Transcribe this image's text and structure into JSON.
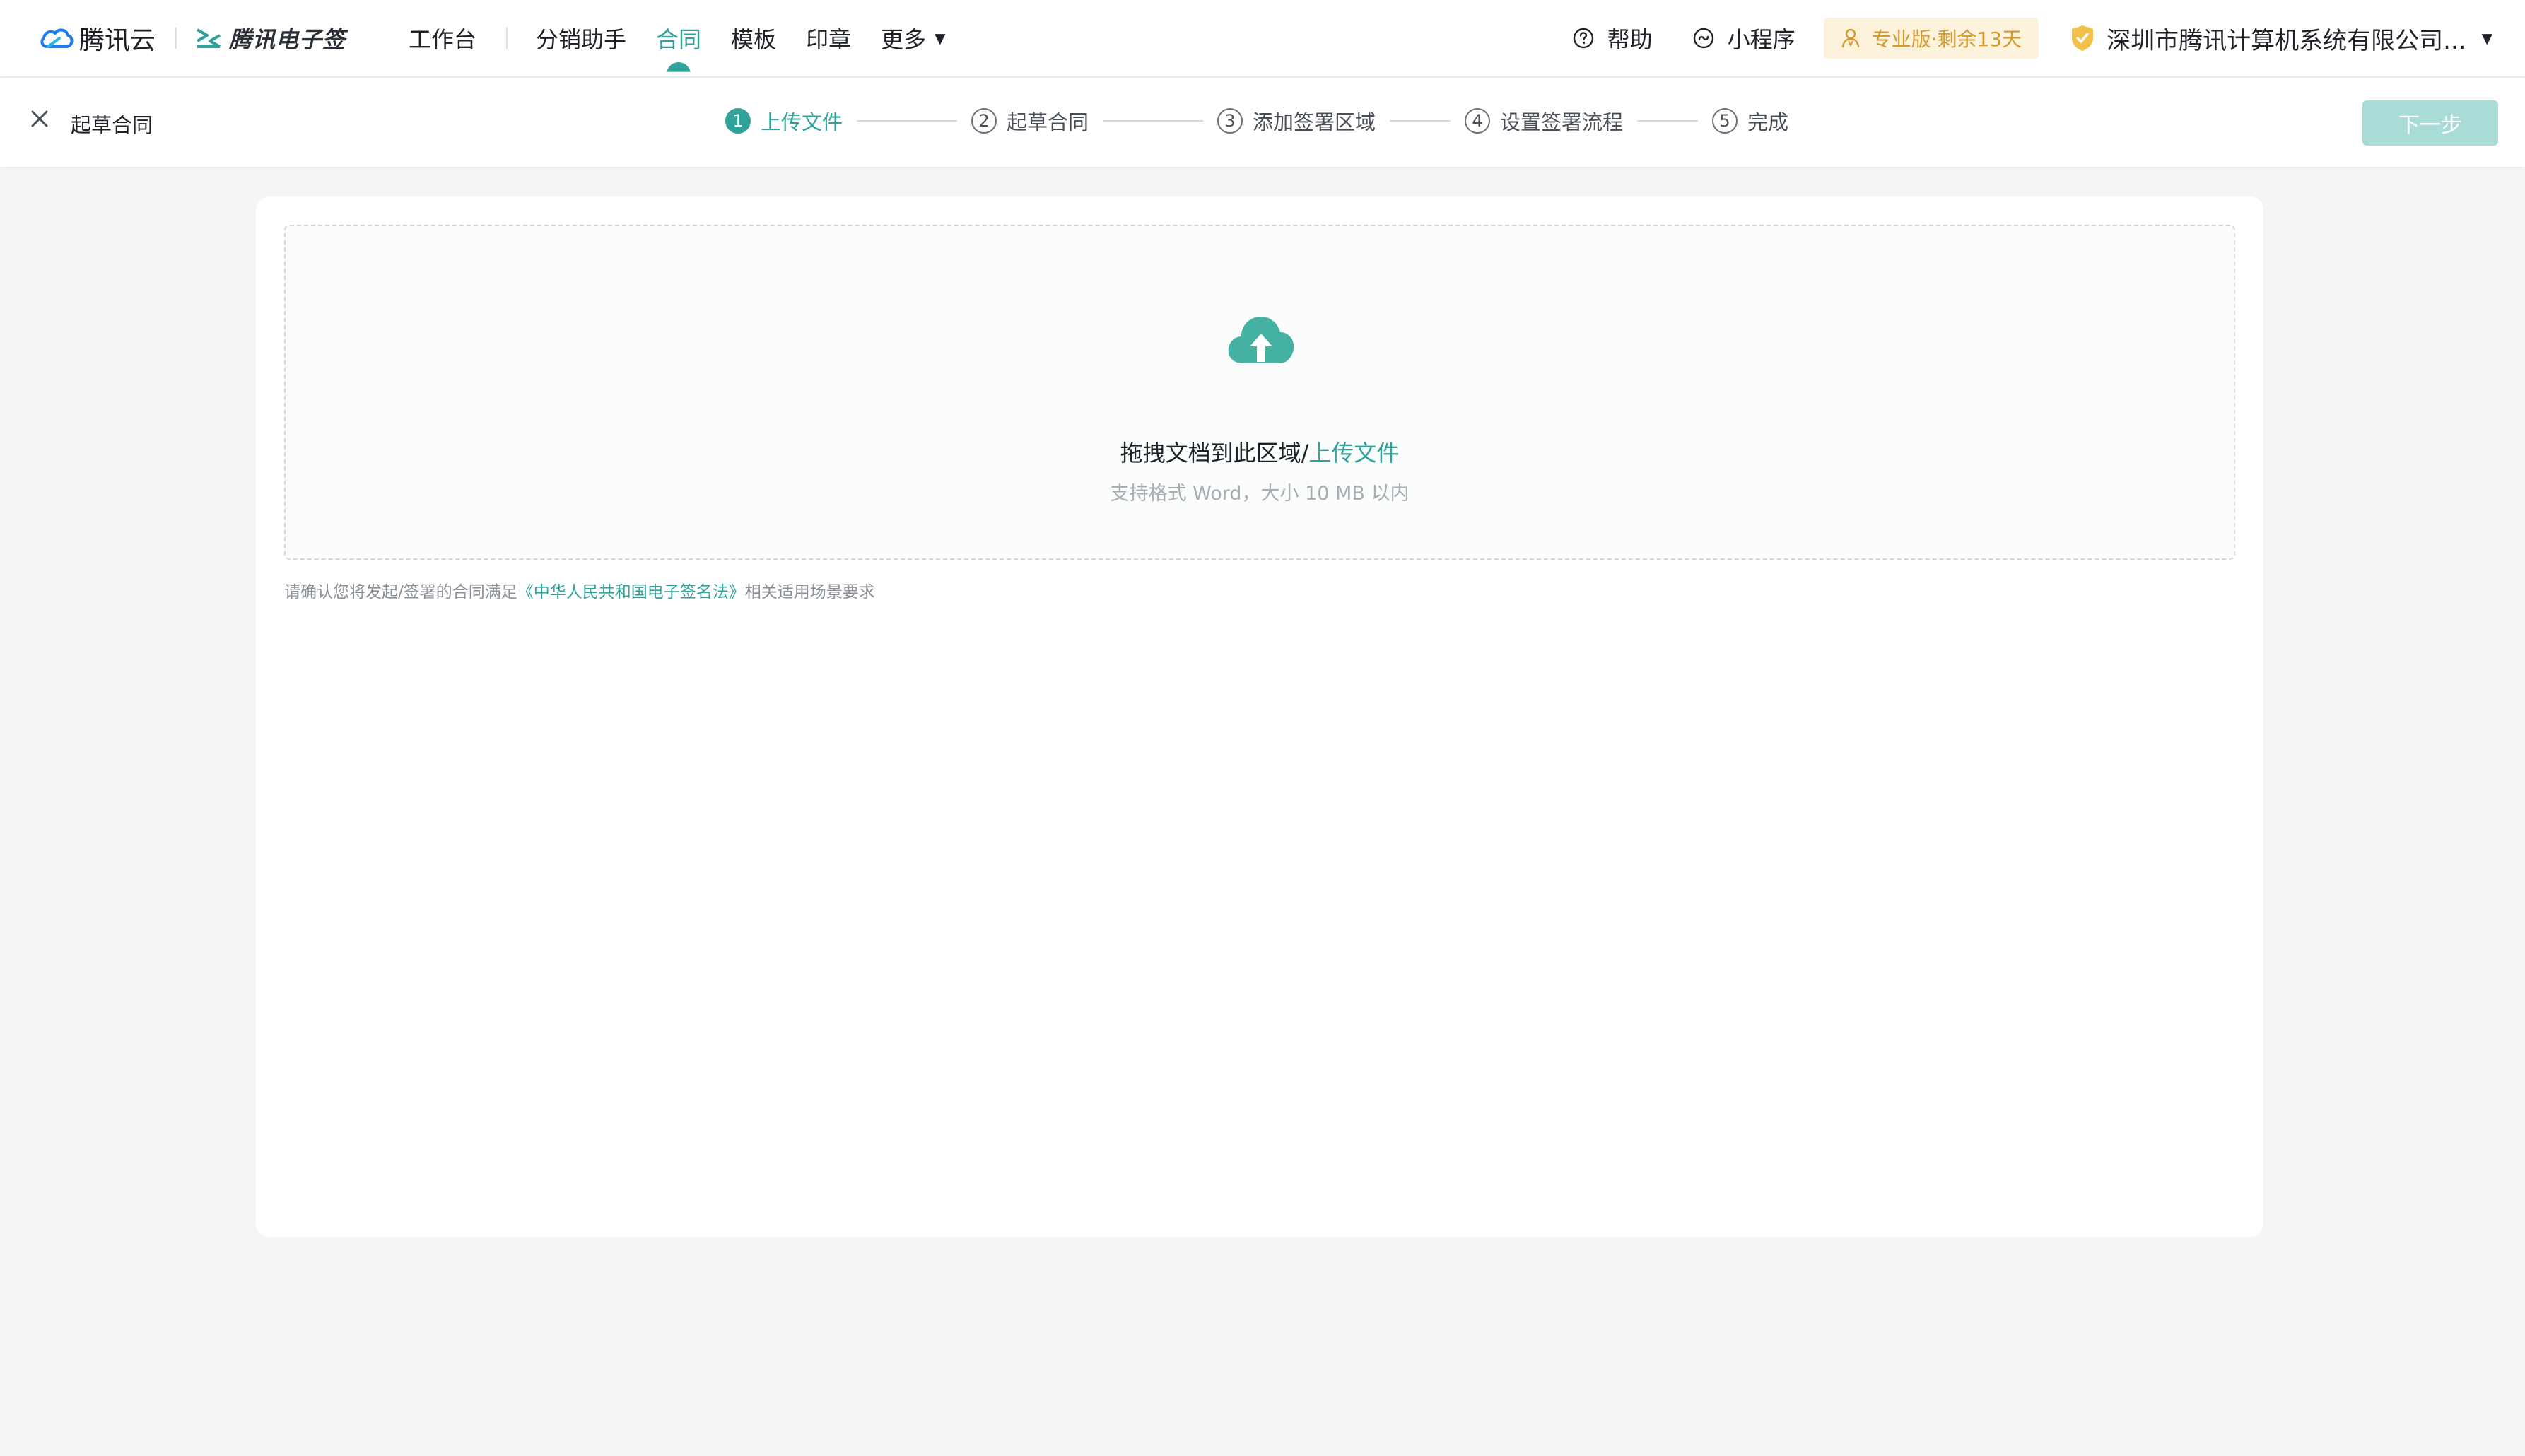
{
  "brand": {
    "cloud_name": "腾讯云",
    "product_name": "腾讯电子签"
  },
  "nav": {
    "items": [
      "工作台",
      "分销助手",
      "合同",
      "模板",
      "印章",
      "更多"
    ],
    "active": "合同"
  },
  "nav_right": {
    "help": "帮助",
    "miniprogram": "小程序",
    "plan_badge": "专业版·剩余13天",
    "company": "深圳市腾讯计算机系统有限公司..."
  },
  "stepbar": {
    "page_title": "起草合同",
    "steps": [
      {
        "num": "1",
        "label": "上传文件"
      },
      {
        "num": "2",
        "label": "起草合同"
      },
      {
        "num": "3",
        "label": "添加签署区域"
      },
      {
        "num": "4",
        "label": "设置签署流程"
      },
      {
        "num": "5",
        "label": "完成"
      }
    ],
    "active_step": 1,
    "next_label": "下一步"
  },
  "upload": {
    "main_text": "拖拽文档到此区域/",
    "link_text": "上传文件",
    "sub_text": "支持格式 Word，大小 10 MB 以内"
  },
  "legal": {
    "prefix": "请确认您将发起/签署的合同满足",
    "law_link": "《中华人民共和国电子签名法》",
    "suffix": "相关适用场景要求"
  },
  "colors": {
    "accent": "#2fa39a",
    "badge_bg": "#fdf3dd",
    "badge_text": "#d39a2b",
    "disabled_button": "#a9dcd6",
    "page_bg": "#f4f5f7"
  }
}
